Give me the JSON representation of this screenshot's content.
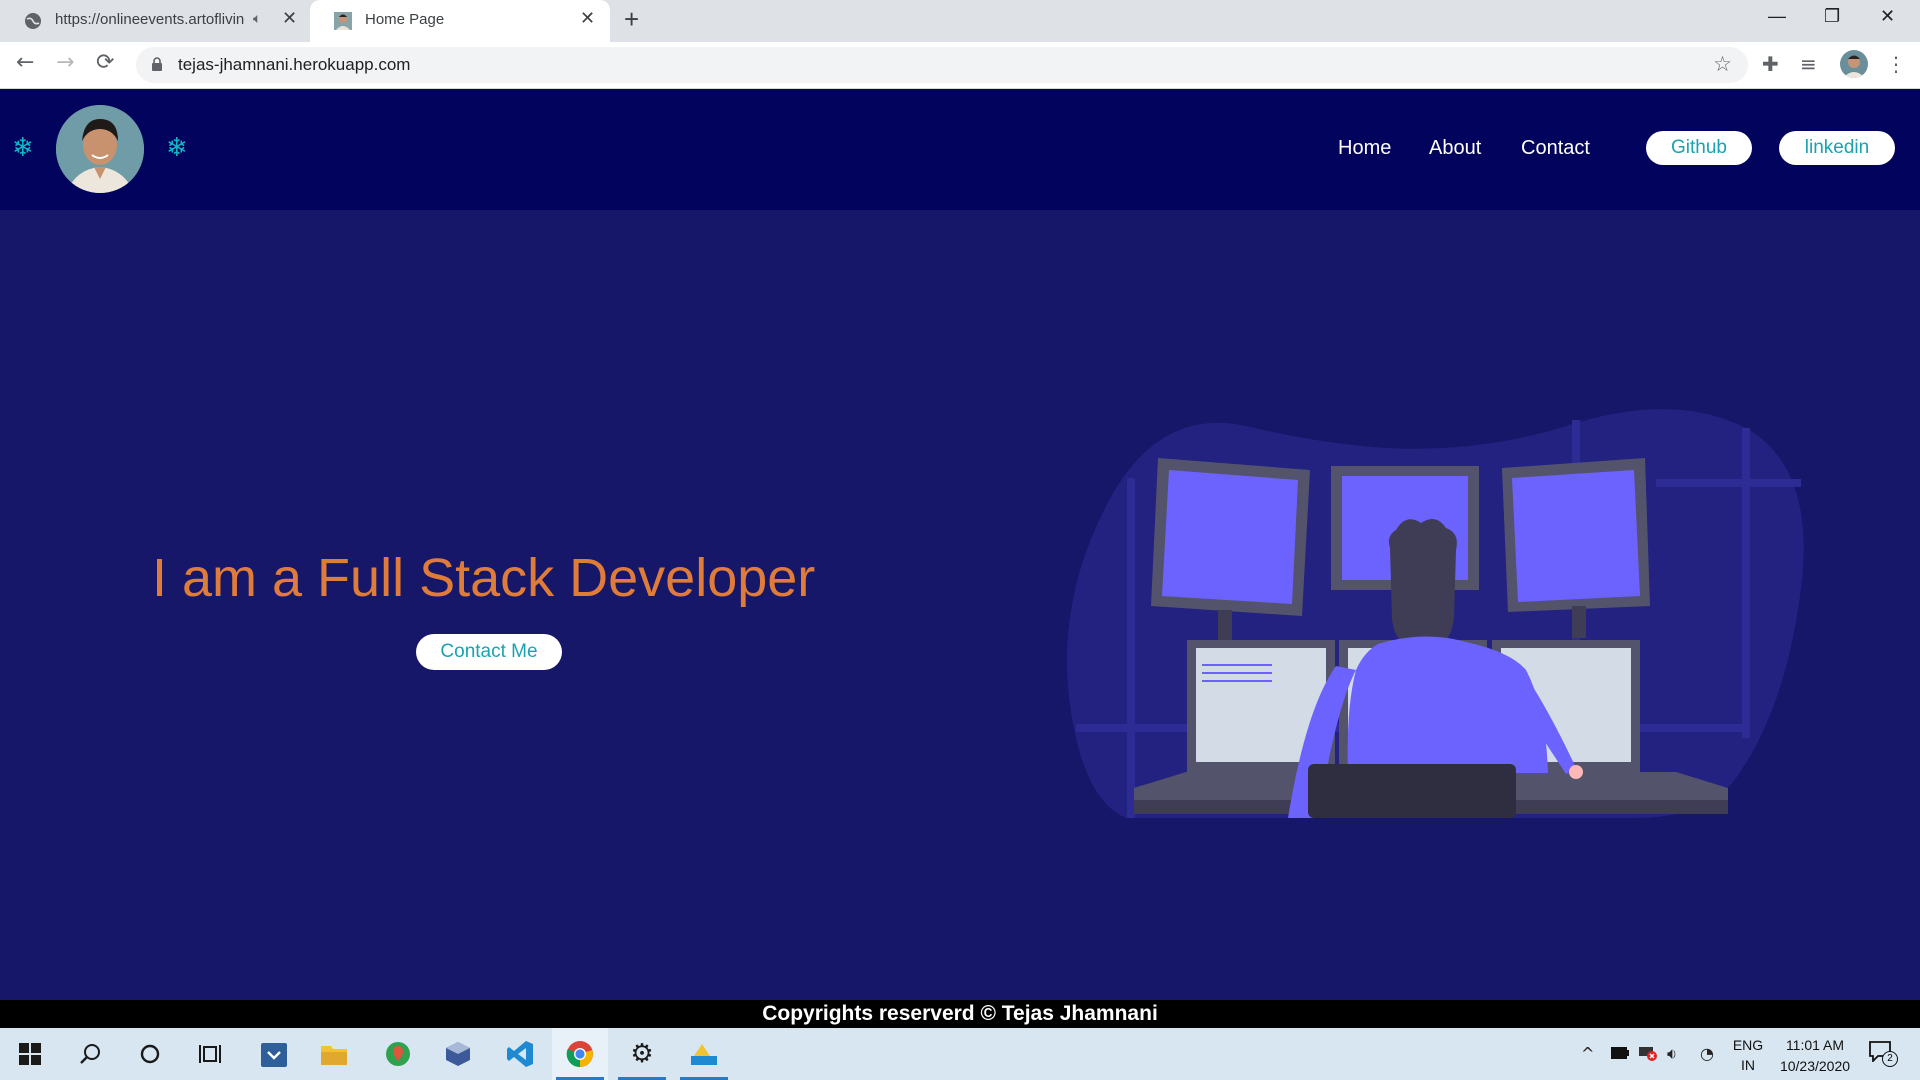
{
  "browser": {
    "tabs": [
      {
        "title": "https://onlineevents.artofliving",
        "active": false
      },
      {
        "title": "Home Page",
        "active": true
      }
    ],
    "new_tab": "+",
    "url": "tejas-jhamnani.herokuapp.com",
    "window_controls": {
      "minimize": "—",
      "restore": "❐",
      "close": "✕"
    }
  },
  "site": {
    "nav": [
      "Home",
      "About",
      "Contact"
    ],
    "buttons": {
      "github": "Github",
      "linkedin": "linkedin"
    },
    "hero": {
      "title": "I am a Full Stack Developer",
      "cta": "Contact Me"
    },
    "footer": "Copyrights reserverd © Tejas Jhamnani"
  },
  "taskbar": {
    "language": "ENG",
    "region": "IN",
    "time": "11:01 AM",
    "date": "10/23/2020",
    "notification_count": "2"
  },
  "colors": {
    "header_bg": "#02035c",
    "hero_bg": "#161769",
    "accent_teal": "#19a3b0",
    "title_orange": "#e07c3a"
  }
}
